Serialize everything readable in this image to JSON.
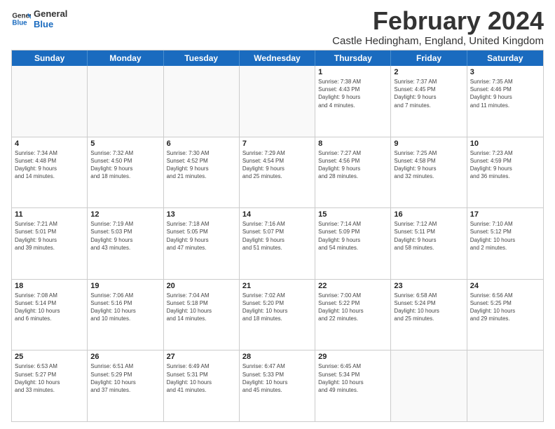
{
  "logo": {
    "line1": "General",
    "line2": "Blue"
  },
  "title": "February 2024",
  "subtitle": "Castle Hedingham, England, United Kingdom",
  "days": [
    "Sunday",
    "Monday",
    "Tuesday",
    "Wednesday",
    "Thursday",
    "Friday",
    "Saturday"
  ],
  "weeks": [
    [
      {
        "day": "",
        "info": ""
      },
      {
        "day": "",
        "info": ""
      },
      {
        "day": "",
        "info": ""
      },
      {
        "day": "",
        "info": ""
      },
      {
        "day": "1",
        "info": "Sunrise: 7:38 AM\nSunset: 4:43 PM\nDaylight: 9 hours\nand 4 minutes."
      },
      {
        "day": "2",
        "info": "Sunrise: 7:37 AM\nSunset: 4:45 PM\nDaylight: 9 hours\nand 7 minutes."
      },
      {
        "day": "3",
        "info": "Sunrise: 7:35 AM\nSunset: 4:46 PM\nDaylight: 9 hours\nand 11 minutes."
      }
    ],
    [
      {
        "day": "4",
        "info": "Sunrise: 7:34 AM\nSunset: 4:48 PM\nDaylight: 9 hours\nand 14 minutes."
      },
      {
        "day": "5",
        "info": "Sunrise: 7:32 AM\nSunset: 4:50 PM\nDaylight: 9 hours\nand 18 minutes."
      },
      {
        "day": "6",
        "info": "Sunrise: 7:30 AM\nSunset: 4:52 PM\nDaylight: 9 hours\nand 21 minutes."
      },
      {
        "day": "7",
        "info": "Sunrise: 7:29 AM\nSunset: 4:54 PM\nDaylight: 9 hours\nand 25 minutes."
      },
      {
        "day": "8",
        "info": "Sunrise: 7:27 AM\nSunset: 4:56 PM\nDaylight: 9 hours\nand 28 minutes."
      },
      {
        "day": "9",
        "info": "Sunrise: 7:25 AM\nSunset: 4:58 PM\nDaylight: 9 hours\nand 32 minutes."
      },
      {
        "day": "10",
        "info": "Sunrise: 7:23 AM\nSunset: 4:59 PM\nDaylight: 9 hours\nand 36 minutes."
      }
    ],
    [
      {
        "day": "11",
        "info": "Sunrise: 7:21 AM\nSunset: 5:01 PM\nDaylight: 9 hours\nand 39 minutes."
      },
      {
        "day": "12",
        "info": "Sunrise: 7:19 AM\nSunset: 5:03 PM\nDaylight: 9 hours\nand 43 minutes."
      },
      {
        "day": "13",
        "info": "Sunrise: 7:18 AM\nSunset: 5:05 PM\nDaylight: 9 hours\nand 47 minutes."
      },
      {
        "day": "14",
        "info": "Sunrise: 7:16 AM\nSunset: 5:07 PM\nDaylight: 9 hours\nand 51 minutes."
      },
      {
        "day": "15",
        "info": "Sunrise: 7:14 AM\nSunset: 5:09 PM\nDaylight: 9 hours\nand 54 minutes."
      },
      {
        "day": "16",
        "info": "Sunrise: 7:12 AM\nSunset: 5:11 PM\nDaylight: 9 hours\nand 58 minutes."
      },
      {
        "day": "17",
        "info": "Sunrise: 7:10 AM\nSunset: 5:12 PM\nDaylight: 10 hours\nand 2 minutes."
      }
    ],
    [
      {
        "day": "18",
        "info": "Sunrise: 7:08 AM\nSunset: 5:14 PM\nDaylight: 10 hours\nand 6 minutes."
      },
      {
        "day": "19",
        "info": "Sunrise: 7:06 AM\nSunset: 5:16 PM\nDaylight: 10 hours\nand 10 minutes."
      },
      {
        "day": "20",
        "info": "Sunrise: 7:04 AM\nSunset: 5:18 PM\nDaylight: 10 hours\nand 14 minutes."
      },
      {
        "day": "21",
        "info": "Sunrise: 7:02 AM\nSunset: 5:20 PM\nDaylight: 10 hours\nand 18 minutes."
      },
      {
        "day": "22",
        "info": "Sunrise: 7:00 AM\nSunset: 5:22 PM\nDaylight: 10 hours\nand 22 minutes."
      },
      {
        "day": "23",
        "info": "Sunrise: 6:58 AM\nSunset: 5:24 PM\nDaylight: 10 hours\nand 25 minutes."
      },
      {
        "day": "24",
        "info": "Sunrise: 6:56 AM\nSunset: 5:25 PM\nDaylight: 10 hours\nand 29 minutes."
      }
    ],
    [
      {
        "day": "25",
        "info": "Sunrise: 6:53 AM\nSunset: 5:27 PM\nDaylight: 10 hours\nand 33 minutes."
      },
      {
        "day": "26",
        "info": "Sunrise: 6:51 AM\nSunset: 5:29 PM\nDaylight: 10 hours\nand 37 minutes."
      },
      {
        "day": "27",
        "info": "Sunrise: 6:49 AM\nSunset: 5:31 PM\nDaylight: 10 hours\nand 41 minutes."
      },
      {
        "day": "28",
        "info": "Sunrise: 6:47 AM\nSunset: 5:33 PM\nDaylight: 10 hours\nand 45 minutes."
      },
      {
        "day": "29",
        "info": "Sunrise: 6:45 AM\nSunset: 5:34 PM\nDaylight: 10 hours\nand 49 minutes."
      },
      {
        "day": "",
        "info": ""
      },
      {
        "day": "",
        "info": ""
      }
    ]
  ]
}
